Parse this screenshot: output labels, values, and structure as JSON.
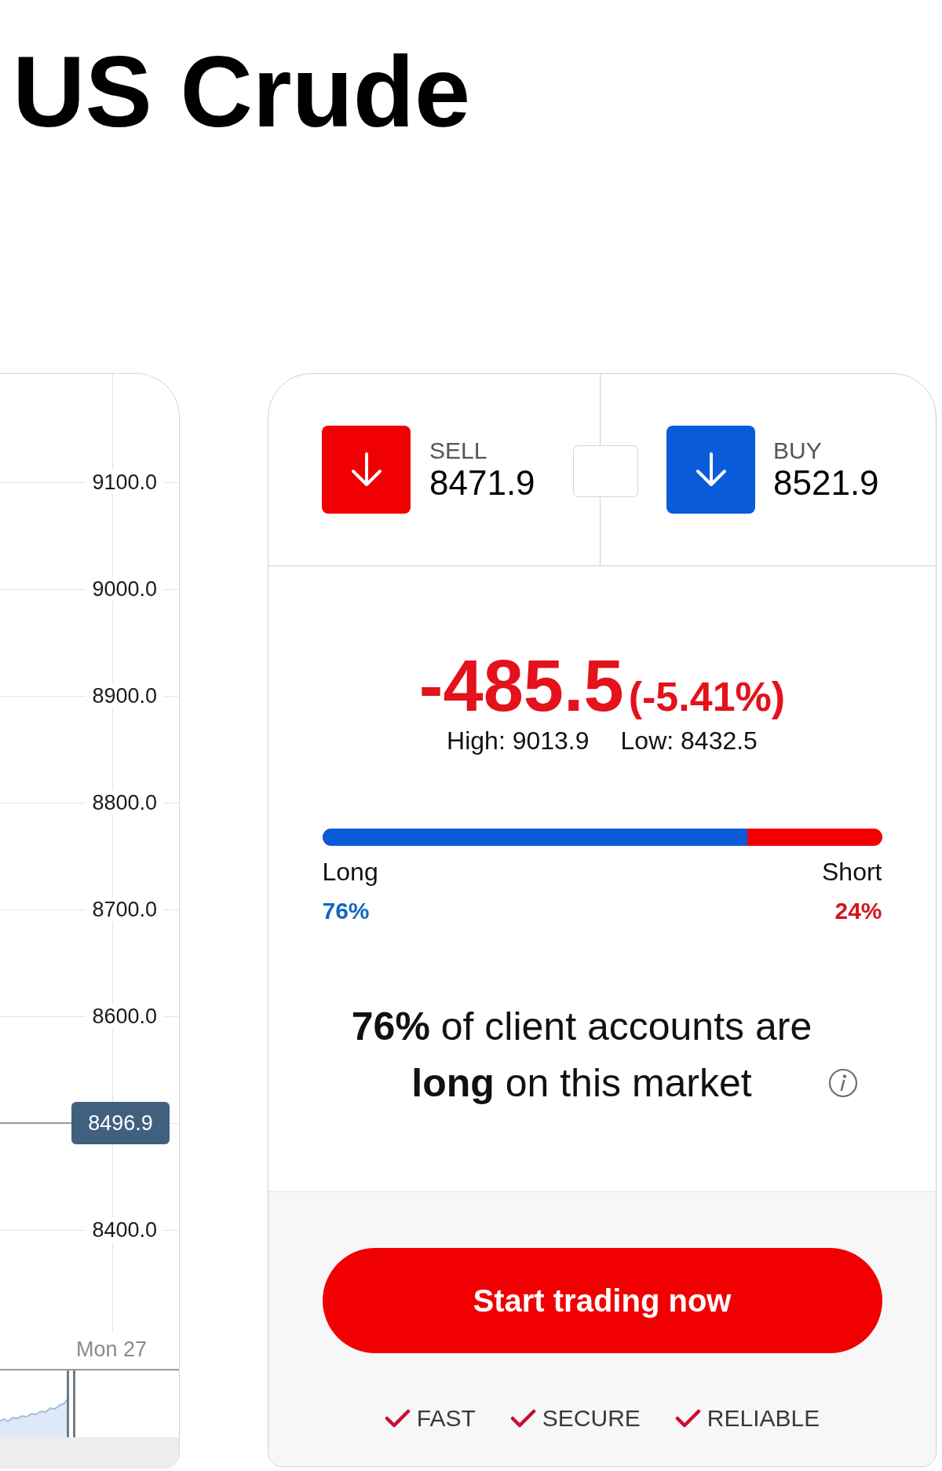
{
  "title": "US Crude",
  "chart": {
    "axis_rows": [
      {
        "kind": "tick",
        "label": "9100.0"
      },
      {
        "kind": "tick",
        "label": "9000.0"
      },
      {
        "kind": "tick",
        "label": "8900.0"
      },
      {
        "kind": "tick",
        "label": "8800.0"
      },
      {
        "kind": "tick",
        "label": "8700.0"
      },
      {
        "kind": "tick",
        "label": "8600.0"
      },
      {
        "kind": "price",
        "label": "8496.9"
      },
      {
        "kind": "tick",
        "label": "8400.0"
      }
    ],
    "x_label": "Mon 27"
  },
  "quote": {
    "sides": [
      {
        "kind": "sell",
        "label": "SELL",
        "price": "8471.9",
        "down": true
      },
      {
        "kind": "buy",
        "label": "BUY",
        "price": "8521.9",
        "down": true
      }
    ]
  },
  "change": {
    "negative": true,
    "value": "-485.5",
    "percent": "(-5.41%)",
    "high": "High: 9013.9",
    "low": "Low: 8432.5"
  },
  "sentiment": {
    "level": 0.76,
    "long_label": "Long",
    "long_percent": "76%",
    "short_label": "Short",
    "short_percent": "24%",
    "summary": "**76%** of client accounts are **long** on this market"
  },
  "cta": {
    "label": "Start trading now"
  },
  "features": [
    "FAST",
    "SECURE",
    "RELIABLE"
  ]
}
